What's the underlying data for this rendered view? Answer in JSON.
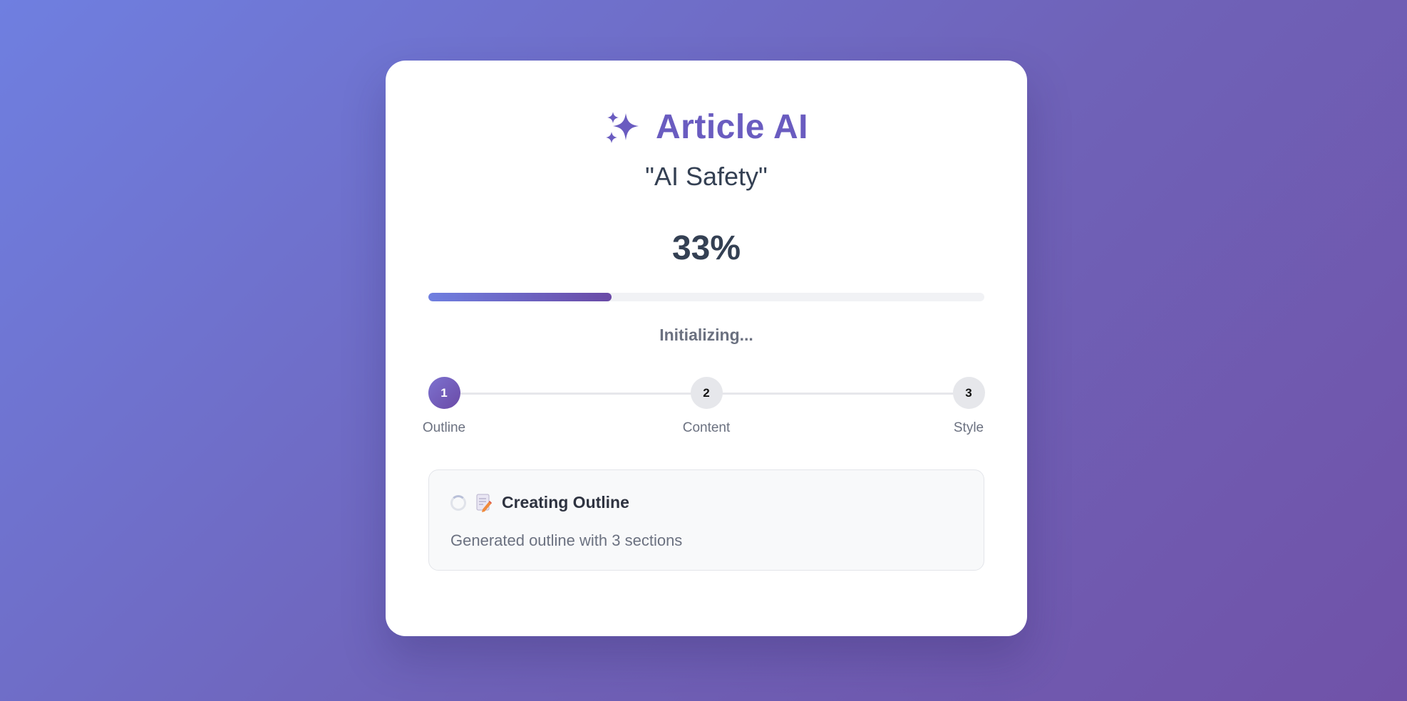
{
  "app": {
    "title": "Article AI",
    "icon": "sparkles-icon"
  },
  "topic": "\"AI Safety\"",
  "progress": {
    "percent_label": "33%",
    "value": 0.33,
    "status": "Initializing..."
  },
  "steps": [
    {
      "number": "1",
      "label": "Outline",
      "state": "active"
    },
    {
      "number": "2",
      "label": "Content",
      "state": "pending"
    },
    {
      "number": "3",
      "label": "Style",
      "state": "pending"
    }
  ],
  "task": {
    "title": "Creating Outline",
    "description": "Generated outline with 3 sections",
    "icons": [
      "spinner-icon",
      "memo-icon"
    ]
  },
  "colors": {
    "accent": "#6a5cc0",
    "progress_start": "#6f7fe0",
    "progress_end": "#6a4aa6",
    "text_dark": "#344053",
    "text_muted": "#6b7180"
  }
}
